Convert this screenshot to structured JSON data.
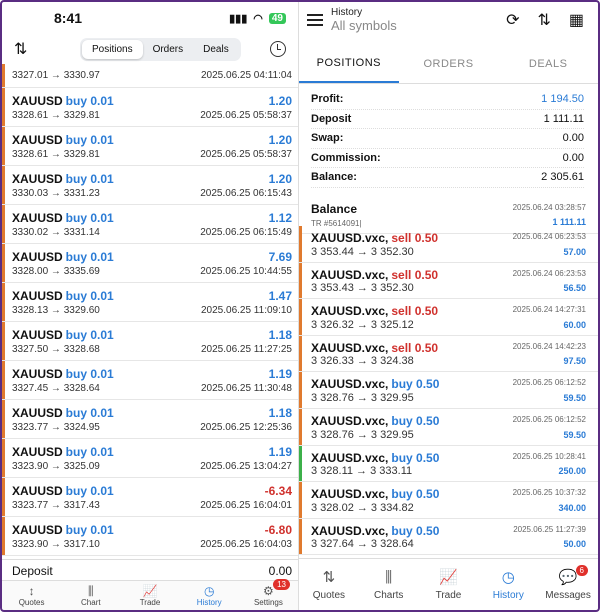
{
  "left": {
    "status": {
      "time": "8:41",
      "battery": "49"
    },
    "toolbar": {
      "tabs": [
        "Positions",
        "Orders",
        "Deals"
      ],
      "active_tab": "Positions"
    },
    "first_trade": {
      "prices": "3327.01 → 3330.97",
      "date": "2025.06.25 04:11:04"
    },
    "trades": [
      {
        "symbol": "XAUUSD",
        "side": "buy 0.01",
        "profit": "1.20",
        "prices": "3328.61 → 3329.81",
        "date": "2025.06.25 05:58:37"
      },
      {
        "symbol": "XAUUSD",
        "side": "buy 0.01",
        "profit": "1.20",
        "prices": "3328.61 → 3329.81",
        "date": "2025.06.25 05:58:37"
      },
      {
        "symbol": "XAUUSD",
        "side": "buy 0.01",
        "profit": "1.20",
        "prices": "3330.03 → 3331.23",
        "date": "2025.06.25 06:15:43"
      },
      {
        "symbol": "XAUUSD",
        "side": "buy 0.01",
        "profit": "1.12",
        "prices": "3330.02 → 3331.14",
        "date": "2025.06.25 06:15:49"
      },
      {
        "symbol": "XAUUSD",
        "side": "buy 0.01",
        "profit": "7.69",
        "prices": "3328.00 → 3335.69",
        "date": "2025.06.25 10:44:55"
      },
      {
        "symbol": "XAUUSD",
        "side": "buy 0.01",
        "profit": "1.47",
        "prices": "3328.13 → 3329.60",
        "date": "2025.06.25 11:09:10"
      },
      {
        "symbol": "XAUUSD",
        "side": "buy 0.01",
        "profit": "1.18",
        "prices": "3327.50 → 3328.68",
        "date": "2025.06.25 11:27:25"
      },
      {
        "symbol": "XAUUSD",
        "side": "buy 0.01",
        "profit": "1.19",
        "prices": "3327.45 → 3328.64",
        "date": "2025.06.25 11:30:48"
      },
      {
        "symbol": "XAUUSD",
        "side": "buy 0.01",
        "profit": "1.18",
        "prices": "3323.77 → 3324.95",
        "date": "2025.06.25 12:25:36"
      },
      {
        "symbol": "XAUUSD",
        "side": "buy 0.01",
        "profit": "1.19",
        "prices": "3323.90 → 3325.09",
        "date": "2025.06.25 13:04:27"
      },
      {
        "symbol": "XAUUSD",
        "side": "buy 0.01",
        "profit": "-6.34",
        "prices": "3323.77 → 3317.43",
        "date": "2025.06.25 16:04:01"
      },
      {
        "symbol": "XAUUSD",
        "side": "buy 0.01",
        "profit": "-6.80",
        "prices": "3323.90 → 3317.10",
        "date": "2025.06.25 16:04:03"
      }
    ],
    "deposit": {
      "label": "Deposit",
      "value": "0.00"
    },
    "nav": [
      {
        "label": "Quotes",
        "icon": "↕"
      },
      {
        "label": "Chart",
        "icon": "⫼"
      },
      {
        "label": "Trade",
        "icon": "📈"
      },
      {
        "label": "History",
        "icon": "◷"
      },
      {
        "label": "Settings",
        "icon": "⚙",
        "badge": "13"
      }
    ]
  },
  "right": {
    "header": {
      "title": "History",
      "subtitle": "All symbols"
    },
    "tabs": [
      "POSITIONS",
      "ORDERS",
      "DEALS"
    ],
    "summary": [
      {
        "label": "Profit:",
        "value": "1 194.50",
        "blue": true
      },
      {
        "label": "Deposit",
        "value": "1 111.11",
        "blue": false
      },
      {
        "label": "Swap:",
        "value": "0.00",
        "blue": false
      },
      {
        "label": "Commission:",
        "value": "0.00",
        "blue": false
      },
      {
        "label": "Balance:",
        "value": "2 305.61",
        "blue": false
      }
    ],
    "balance_record": {
      "title": "Balance",
      "ref": "TR #5614091|",
      "date": "2025.06.24 03:28:57",
      "amount": "1 111.11"
    },
    "deals": [
      {
        "symbol": "XAUUSD.vxc,",
        "side": "sell 0.50",
        "type": "sell",
        "prices": "3 353.44 → 3 352.30",
        "date": "2025.06.24 06:23:53",
        "profit": "57.00",
        "bar": "orange"
      },
      {
        "symbol": "XAUUSD.vxc,",
        "side": "sell 0.50",
        "type": "sell",
        "prices": "3 353.43 → 3 352.30",
        "date": "2025.06.24 06:23:53",
        "profit": "56.50",
        "bar": "orange"
      },
      {
        "symbol": "XAUUSD.vxc,",
        "side": "sell 0.50",
        "type": "sell",
        "prices": "3 326.32 → 3 325.12",
        "date": "2025.06.24 14:27:31",
        "profit": "60.00",
        "bar": "orange"
      },
      {
        "symbol": "XAUUSD.vxc,",
        "side": "sell 0.50",
        "type": "sell",
        "prices": "3 326.33 → 3 324.38",
        "date": "2025.06.24 14:42:23",
        "profit": "97.50",
        "bar": "orange"
      },
      {
        "symbol": "XAUUSD.vxc,",
        "side": "buy 0.50",
        "type": "buy",
        "prices": "3 328.76 → 3 329.95",
        "date": "2025.06.25 06:12:52",
        "profit": "59.50",
        "bar": "orange"
      },
      {
        "symbol": "XAUUSD.vxc,",
        "side": "buy 0.50",
        "type": "buy",
        "prices": "3 328.76 → 3 329.95",
        "date": "2025.06.25 06:12:52",
        "profit": "59.50",
        "bar": "orange"
      },
      {
        "symbol": "XAUUSD.vxc,",
        "side": "buy 0.50",
        "type": "buy",
        "prices": "3 328.11 → 3 333.11",
        "date": "2025.06.25 10:28:41",
        "profit": "250.00",
        "bar": "green"
      },
      {
        "symbol": "XAUUSD.vxc,",
        "side": "buy 0.50",
        "type": "buy",
        "prices": "3 328.02 → 3 334.82",
        "date": "2025.06.25 10:37:32",
        "profit": "340.00",
        "bar": "orange"
      },
      {
        "symbol": "XAUUSD.vxc,",
        "side": "buy 0.50",
        "type": "buy",
        "prices": "3 327.64 → 3 328.64",
        "date": "2025.06.25 11:27:39",
        "profit": "50.00",
        "bar": "orange"
      }
    ],
    "nav": [
      {
        "label": "Quotes",
        "icon": "⇅"
      },
      {
        "label": "Charts",
        "icon": "⫼"
      },
      {
        "label": "Trade",
        "icon": "📈"
      },
      {
        "label": "History",
        "icon": "◷"
      },
      {
        "label": "Messages",
        "icon": "💬",
        "badge": "6"
      }
    ]
  },
  "colors": {
    "accent": "#2a7bd5",
    "loss": "#d0312d",
    "bar_orange": "#e07a2e",
    "bar_green": "#3cb04a",
    "frame": "#5a2d82"
  }
}
